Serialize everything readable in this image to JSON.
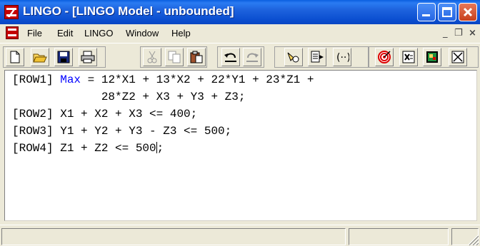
{
  "window": {
    "title": "LINGO - [LINGO Model - unbounded]"
  },
  "menu": {
    "items": [
      "File",
      "Edit",
      "LINGO",
      "Window",
      "Help"
    ],
    "minimize_symbol": "_",
    "restore_symbol": "❐",
    "close_symbol": "×"
  },
  "toolbar": {
    "buttons": [
      "new-icon",
      "open-icon",
      "save-icon",
      "print-icon",
      "cut-icon",
      "copy-icon",
      "paste-icon",
      "undo-icon",
      "redo-icon",
      "find-icon",
      "goto-line-icon",
      "match-paren-icon",
      "solve-icon",
      "solution-icon",
      "matrix-picture-icon",
      "close-all-icon"
    ]
  },
  "editor": {
    "lines": [
      {
        "pre": "[ROW1] ",
        "kw": "Max",
        "post": " = 12*X1 + 13*X2 + 22*Y1 + 23*Z1 +"
      },
      {
        "pre": "             28*Z2 + X3 + Y3 + Z3;",
        "kw": "",
        "post": ""
      },
      {
        "pre": "[ROW2] X1 + X2 + X3 <= 400;",
        "kw": "",
        "post": ""
      },
      {
        "pre": "[ROW3] Y1 + Y2 + Y3 - Z3 <= 500;",
        "kw": "",
        "post": ""
      },
      {
        "pre": "[ROW4] Z1 + Z2 <= 500",
        "kw": "",
        "post": ";"
      }
    ],
    "keyword_color": "#0000ff"
  },
  "statusbar": {
    "panes": [
      "",
      "",
      ""
    ]
  }
}
